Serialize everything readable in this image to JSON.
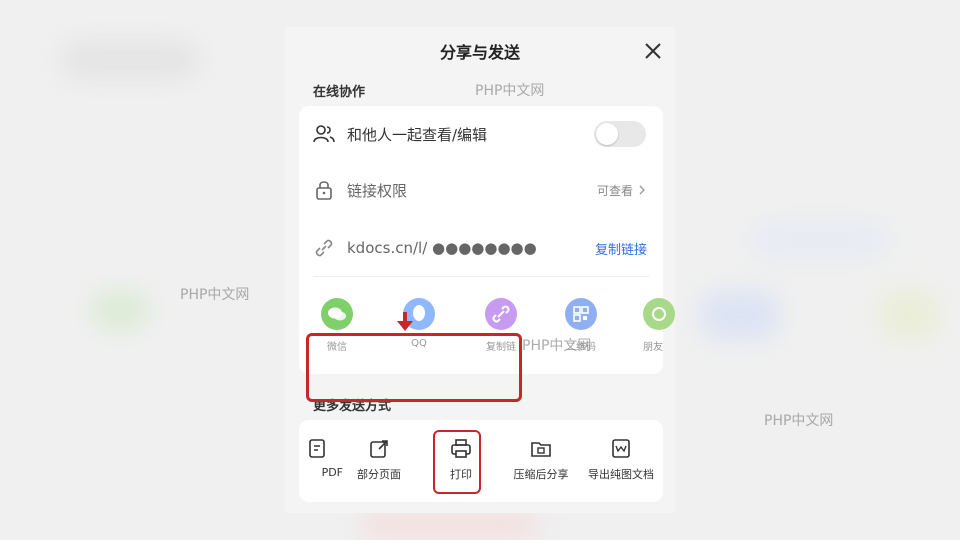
{
  "dialog": {
    "title": "分享与发送",
    "online_section": "在线协作",
    "more_section": "更多发送方式"
  },
  "online": {
    "collab_label": "和他人一起查看/编辑",
    "permission_label": "链接权限",
    "permission_value": "可查看",
    "link_text": "kdocs.cn/l/ ●●●●●●●●",
    "copy_link": "复制链接"
  },
  "share_apps": [
    {
      "name": "微信",
      "color": "#7fcf6a",
      "icon": "wechat-icon"
    },
    {
      "name": "QQ",
      "color": "#8fb8ff",
      "icon": "qq-icon"
    },
    {
      "name": "复制链",
      "color": "#c79cf0",
      "icon": "link-icon"
    },
    {
      "name": "二维码",
      "color": "#8fb0f0",
      "icon": "qrcode-icon"
    },
    {
      "name": "朋友",
      "color": "#a8d88a",
      "icon": "moments-icon"
    }
  ],
  "tools": [
    {
      "name": "PDF",
      "icon": "pdf-icon"
    },
    {
      "name": "部分页面",
      "icon": "share-page-icon"
    },
    {
      "name": "打印",
      "icon": "printer-icon"
    },
    {
      "name": "压缩后分享",
      "icon": "zip-icon"
    },
    {
      "name": "导出纯图文档",
      "icon": "image-doc-icon"
    }
  ],
  "watermarks": [
    "PHP中文网",
    "PHP中文网",
    "PHP中文网",
    "PHP中文网"
  ],
  "colors": {
    "accent_blue": "#2f6fe0",
    "highlight_red": "#c8262b"
  }
}
